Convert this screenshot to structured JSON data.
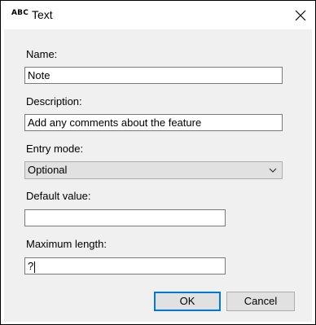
{
  "window": {
    "title_icon": "ABC",
    "title": "Text",
    "close_icon": "close-icon"
  },
  "form": {
    "name_label": "Name:",
    "name_value": "Note",
    "description_label": "Description:",
    "description_value": "Add any comments about the feature",
    "entry_mode_label": "Entry mode:",
    "entry_mode_value": "Optional",
    "default_value_label": "Default value:",
    "default_value_value": "",
    "max_length_label": "Maximum length:",
    "max_length_value": "?"
  },
  "buttons": {
    "ok_label": "OK",
    "cancel_label": "Cancel"
  },
  "colors": {
    "dialog_background": "#f0f0f0",
    "default_button_border": "#0078d7"
  }
}
